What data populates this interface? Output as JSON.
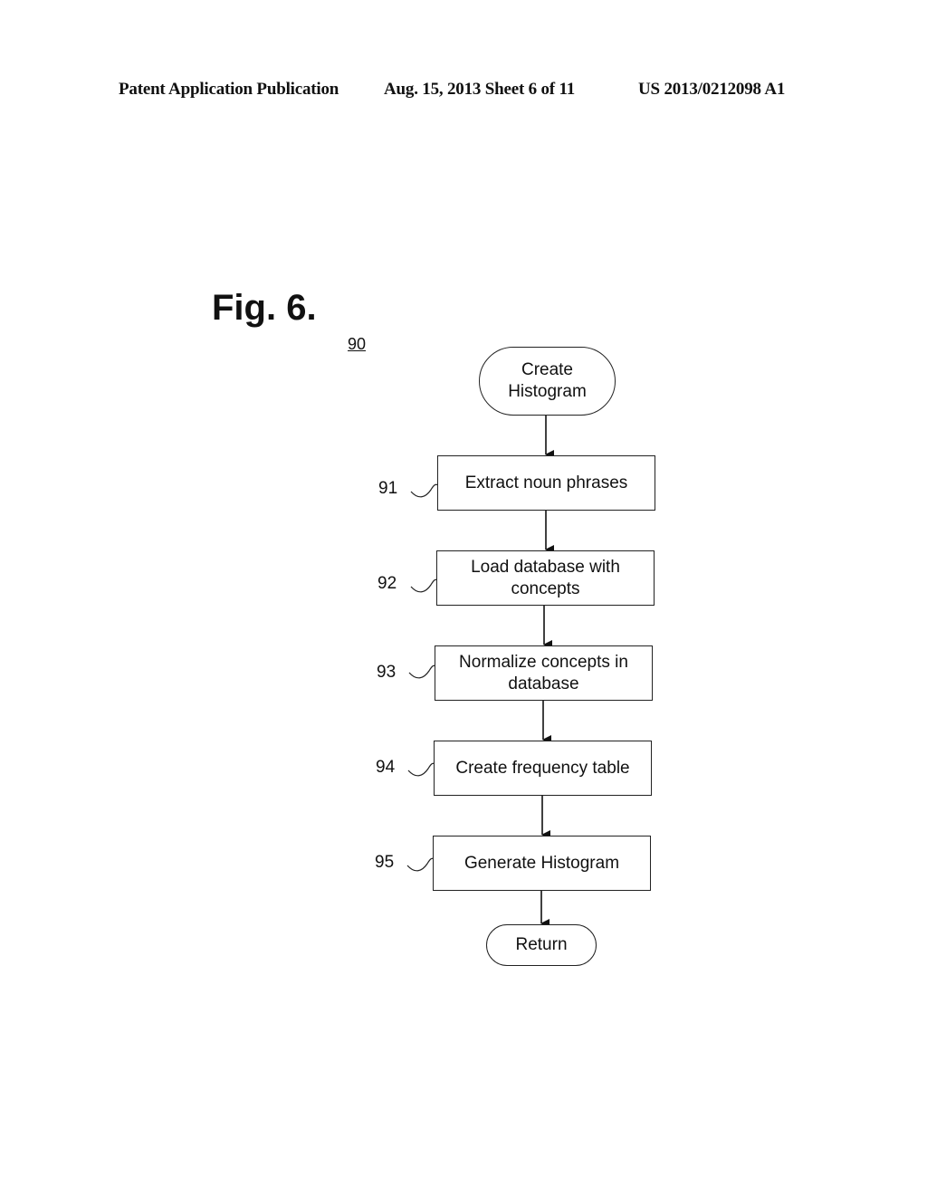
{
  "header": {
    "publication": "Patent Application Publication",
    "date_sheet": "Aug. 15, 2013  Sheet 6 of 11",
    "patent_number": "US 2013/0212098 A1"
  },
  "figure": {
    "title": "Fig. 6.",
    "reference": "90"
  },
  "flowchart": {
    "start": {
      "label": "Create\nHistogram",
      "type": "terminal"
    },
    "steps": [
      {
        "ref": "91",
        "label": "Extract noun phrases"
      },
      {
        "ref": "92",
        "label": "Load database with\nconcepts"
      },
      {
        "ref": "93",
        "label": "Normalize concepts in\ndatabase"
      },
      {
        "ref": "94",
        "label": "Create frequency table"
      },
      {
        "ref": "95",
        "label": "Generate Histogram"
      }
    ],
    "end": {
      "label": "Return",
      "type": "terminal"
    }
  }
}
